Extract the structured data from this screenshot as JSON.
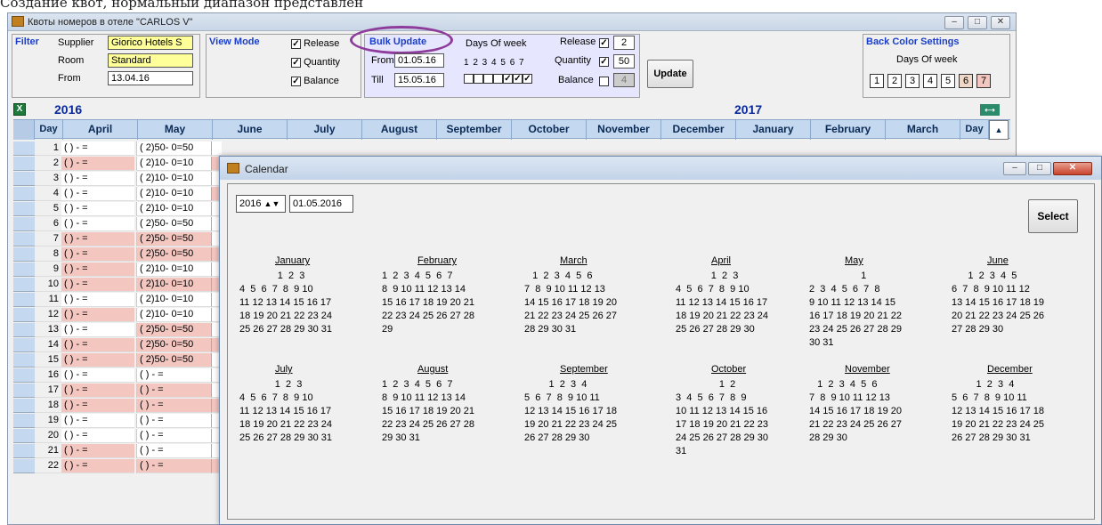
{
  "caption": "Создание квот, нормальный диапазон представлен",
  "main": {
    "title": "Квоты номеров в отеле \"CARLOS V\"",
    "filter": {
      "label": "Filter",
      "supplier_label": "Supplier",
      "supplier_value": "Giorico Hotels S",
      "room_label": "Room",
      "room_value": "Standard",
      "from_label": "From",
      "from_value": "13.04.16"
    },
    "view": {
      "label": "View Mode",
      "release": "Release",
      "quantity": "Quantity",
      "balance": "Balance"
    },
    "bulk": {
      "label": "Bulk Update",
      "from_label": "From",
      "from_value": "01.05.16",
      "till_label": "Till",
      "till_value": "15.05.16",
      "dow_label": "Days Of week",
      "dow_numbers": "1 2 3 4 5 6 7",
      "release_label": "Release",
      "release_value": "2",
      "quantity_label": "Quantity",
      "quantity_value": "50",
      "balance_label": "Balance",
      "balance_value": "4",
      "update": "Update"
    },
    "backcolor": {
      "label": "Back Color Settings",
      "dow_label": "Days Of week",
      "days": [
        "1",
        "2",
        "3",
        "4",
        "5",
        "6",
        "7"
      ]
    },
    "years": {
      "y1": "2016",
      "y2": "2017"
    },
    "columns": {
      "day": "Day",
      "months": [
        "April",
        "May",
        "June",
        "July",
        "August",
        "September",
        "October",
        "November",
        "December",
        "January",
        "February",
        "March"
      ],
      "day_end": "Day"
    },
    "rows": [
      {
        "d": "1",
        "a": "( ) - =",
        "m": "( 2)50- 0=50"
      },
      {
        "d": "2",
        "a": "( ) - =",
        "m": "( 2)10- 0=10"
      },
      {
        "d": "3",
        "a": "( ) - =",
        "m": "( 2)10- 0=10"
      },
      {
        "d": "4",
        "a": "( ) - =",
        "m": "( 2)10- 0=10"
      },
      {
        "d": "5",
        "a": "( ) - =",
        "m": "( 2)10- 0=10"
      },
      {
        "d": "6",
        "a": "( ) - =",
        "m": "( 2)50- 0=50"
      },
      {
        "d": "7",
        "a": "( ) - =",
        "m": "( 2)50- 0=50"
      },
      {
        "d": "8",
        "a": "( ) - =",
        "m": "( 2)50- 0=50"
      },
      {
        "d": "9",
        "a": "( ) - =",
        "m": "( 2)10- 0=10"
      },
      {
        "d": "10",
        "a": "( ) - =",
        "m": "( 2)10- 0=10"
      },
      {
        "d": "11",
        "a": "( ) - =",
        "m": "( 2)10- 0=10"
      },
      {
        "d": "12",
        "a": "( ) - =",
        "m": "( 2)10- 0=10"
      },
      {
        "d": "13",
        "a": "( ) - =",
        "m": "( 2)50- 0=50"
      },
      {
        "d": "14",
        "a": "( ) - =",
        "m": "( 2)50- 0=50"
      },
      {
        "d": "15",
        "a": "( ) - =",
        "m": "( 2)50- 0=50"
      },
      {
        "d": "16",
        "a": "( ) - =",
        "m": "( ) - ="
      },
      {
        "d": "17",
        "a": "( ) - =",
        "m": "( ) - ="
      },
      {
        "d": "18",
        "a": "( ) - =",
        "m": "( ) - ="
      },
      {
        "d": "19",
        "a": "( ) - =",
        "m": "( ) - ="
      },
      {
        "d": "20",
        "a": "( ) - =",
        "m": "( ) - ="
      },
      {
        "d": "21",
        "a": "( ) - =",
        "m": "( ) - ="
      },
      {
        "d": "22",
        "a": "( ) - =",
        "m": "( ) - ="
      }
    ]
  },
  "calendar": {
    "title": "Calendar",
    "year": "2016",
    "date": "01.05.2016",
    "select": "Select",
    "months": [
      {
        "name": "January",
        "l1": "              1  2  3",
        "l2": "4  5  6  7  8  9 10",
        "l3": "11 12 13 14 15 16 17",
        "l4": "18 19 20 21 22 23 24",
        "l5": "25 26 27 28 29 30 31",
        "l6": ""
      },
      {
        "name": "February",
        "l1": "1  2  3  4  5  6  7",
        "l2": "8  9 10 11 12 13 14",
        "l3": "15 16 17 18 19 20 21",
        "l4": "22 23 24 25 26 27 28",
        "l5": "29",
        "l6": ""
      },
      {
        "name": "March",
        "l1": "   1  2  3  4  5  6",
        "l2": "7  8  9 10 11 12 13",
        "l3": "14 15 16 17 18 19 20",
        "l4": "21 22 23 24 25 26 27",
        "l5": "28 29 30 31",
        "l6": ""
      },
      {
        "name": "April",
        "l1": "             1  2  3",
        "l2": "4  5  6  7  8  9 10",
        "l3": "11 12 13 14 15 16 17",
        "l4": "18 19 20 21 22 23 24",
        "l5": "25 26 27 28 29 30",
        "l6": ""
      },
      {
        "name": "May",
        "l1": "                   1",
        "l2": "2  3  4  5  6  7  8",
        "l3": "9 10 11 12 13 14 15",
        "l4": "16 17 18 19 20 21 22",
        "l5": "23 24 25 26 27 28 29",
        "l6": "30 31"
      },
      {
        "name": "June",
        "l1": "      1  2  3  4  5",
        "l2": "6  7  8  9 10 11 12",
        "l3": "13 14 15 16 17 18 19",
        "l4": "20 21 22 23 24 25 26",
        "l5": "27 28 29 30",
        "l6": ""
      },
      {
        "name": "July",
        "l1": "             1  2  3",
        "l2": "4  5  6  7  8  9 10",
        "l3": "11 12 13 14 15 16 17",
        "l4": "18 19 20 21 22 23 24",
        "l5": "25 26 27 28 29 30 31",
        "l6": ""
      },
      {
        "name": "August",
        "l1": "1  2  3  4  5  6  7",
        "l2": "8  9 10 11 12 13 14",
        "l3": "15 16 17 18 19 20 21",
        "l4": "22 23 24 25 26 27 28",
        "l5": "29 30 31",
        "l6": ""
      },
      {
        "name": "September",
        "l1": "         1  2  3  4",
        "l2": "5  6  7  8  9 10 11",
        "l3": "12 13 14 15 16 17 18",
        "l4": "19 20 21 22 23 24 25",
        "l5": "26 27 28 29 30",
        "l6": ""
      },
      {
        "name": "October",
        "l1": "                1  2",
        "l2": "3  4  5  6  7  8  9",
        "l3": "10 11 12 13 14 15 16",
        "l4": "17 18 19 20 21 22 23",
        "l5": "24 25 26 27 28 29 30",
        "l6": "31"
      },
      {
        "name": "November",
        "l1": "   1  2  3  4  5  6",
        "l2": "7  8  9 10 11 12 13",
        "l3": "14 15 16 17 18 19 20",
        "l4": "21 22 23 24 25 26 27",
        "l5": "28 29 30",
        "l6": ""
      },
      {
        "name": "December",
        "l1": "         1  2  3  4",
        "l2": "5  6  7  8  9 10 11",
        "l3": "12 13 14 15 16 17 18",
        "l4": "19 20 21 22 23 24 25",
        "l5": "26 27 28 29 30 31",
        "l6": ""
      }
    ]
  },
  "colors": {
    "accent": "#1a3ec9",
    "yellow": "#ffff99",
    "pink": "#f4c6c0",
    "tan": "#f0d8c8",
    "header": "#c4d8ef",
    "highlight": "#8e3c9c",
    "weekend": "#d00000"
  }
}
